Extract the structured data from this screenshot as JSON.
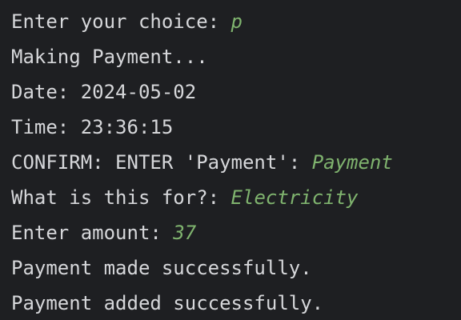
{
  "lines": [
    {
      "prompt": "Enter your choice: ",
      "input": "p"
    },
    {
      "prompt": "Making Payment...",
      "input": ""
    },
    {
      "prompt": "Date: 2024-05-02",
      "input": ""
    },
    {
      "prompt": "Time: 23:36:15",
      "input": ""
    },
    {
      "prompt": "CONFIRM: ENTER 'Payment': ",
      "input": "Payment"
    },
    {
      "prompt": "What is this for?: ",
      "input": "Electricity"
    },
    {
      "prompt": "Enter amount: ",
      "input": "37"
    },
    {
      "prompt": "Payment made successfully.",
      "input": ""
    },
    {
      "prompt": "Payment added successfully.",
      "input": ""
    }
  ],
  "colors": {
    "background": "#1e1f22",
    "text": "#d6d7da",
    "user_input": "#7fb36e"
  }
}
